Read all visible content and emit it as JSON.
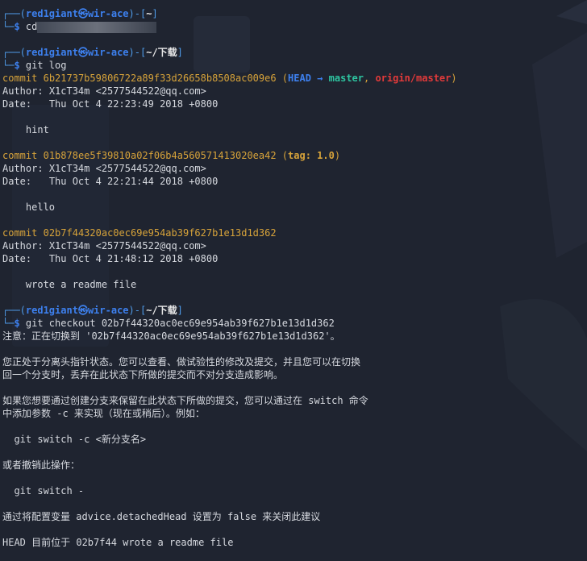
{
  "prompt": {
    "user": "red1giant",
    "at": "㉿",
    "host": "wir-ace"
  },
  "session1": {
    "dir": "~",
    "command": "cd"
  },
  "session2": {
    "dir": "~/下载",
    "command": "git log"
  },
  "commits": [
    {
      "word": "commit",
      "hash": "6b21737b59806722a89f33d26658b8508ac009e6",
      "head": "HEAD",
      "arrow": "→",
      "branch": "master",
      "remote": "origin/master",
      "author_label": "Author:",
      "author": "X1cT34m <2577544522@qq.com>",
      "date_label": "Date:",
      "date": "Thu Oct 4 22:23:49 2018 +0800",
      "message": "hint"
    },
    {
      "word": "commit",
      "hash": "01b878ee5f39810a02f06b4a560571413020ea42",
      "tag": "tag: 1.0",
      "author_label": "Author:",
      "author": "X1cT34m <2577544522@qq.com>",
      "date_label": "Date:",
      "date": "Thu Oct 4 22:21:44 2018 +0800",
      "message": "hello"
    },
    {
      "word": "commit",
      "hash": "02b7f44320ac0ec69e954ab39f627b1e13d1d362",
      "author_label": "Author:",
      "author": "X1cT34m <2577544522@qq.com>",
      "date_label": "Date:",
      "date": "Thu Oct 4 21:48:12 2018 +0800",
      "message": "wrote a readme file"
    }
  ],
  "session3": {
    "dir": "~/下载",
    "command": "git checkout 02b7f44320ac0ec69e954ab39f627b1e13d1d362"
  },
  "output": [
    "注意：正在切换到 '02b7f44320ac0ec69e954ab39f627b1e13d1d362'。",
    "",
    "您正处于分离头指针状态。您可以查看、做试验性的修改及提交，并且您可以在切换",
    "回一个分支时，丢弃在此状态下所做的提交而不对分支造成影响。",
    "",
    "如果您想要通过创建分支来保留在此状态下所做的提交，您可以通过在 switch 命令",
    "中添加参数 -c 来实现（现在或稍后）。例如：",
    "",
    "  git switch -c <新分支名>",
    "",
    "或者撤销此操作：",
    "",
    "  git switch -",
    "",
    "通过将配置变量 advice.detachedHead 设置为 false 来关闭此建议",
    "",
    "HEAD 目前位于 02b7f44 wrote a readme file"
  ],
  "colors": {
    "background": "#1f2430",
    "prompt_frame": "#4f9be8",
    "user_host": "#3d80ee",
    "commit_hash": "#d7a33a",
    "branch": "#2ec4a0",
    "remote": "#e23a3a"
  }
}
